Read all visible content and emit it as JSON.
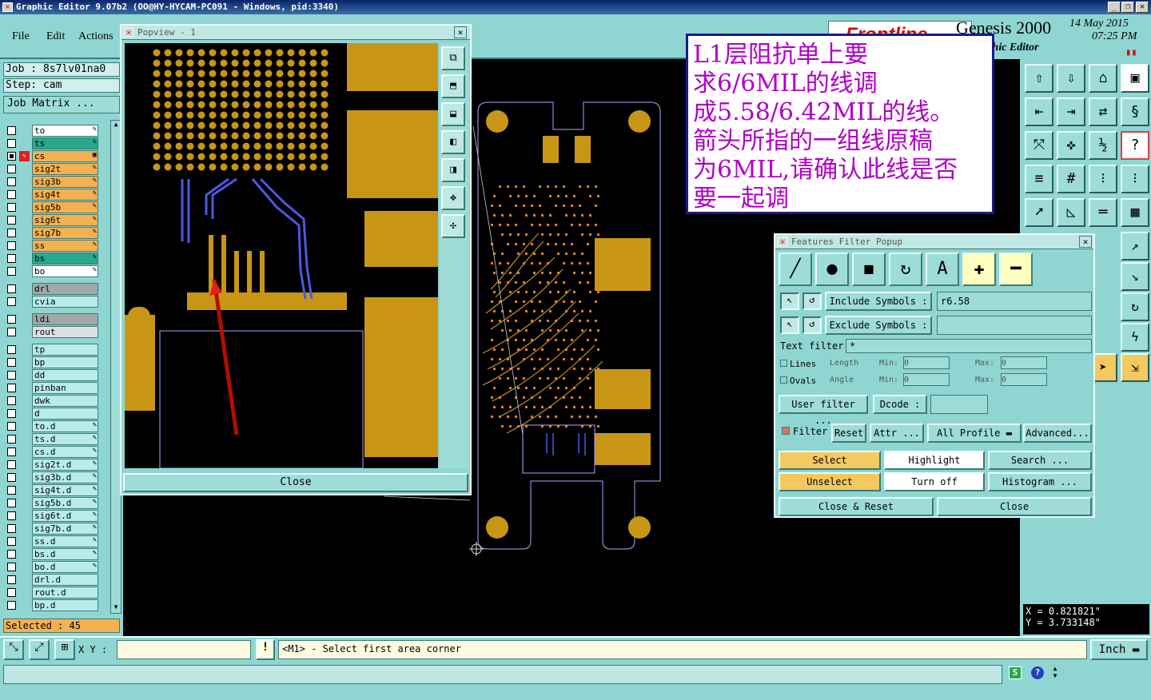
{
  "window_title": "Graphic Editor 9.07b2 (OO@HY-HYCAM-PC091 - Windows, pid:3340)",
  "menu": {
    "file": "File",
    "edit": "Edit",
    "actions": "Actions"
  },
  "job_label": "Job : 8s7lv01na0",
  "step_label": "Step: cam",
  "job_matrix": "Job Matrix ...",
  "layers": [
    {
      "name": "to",
      "color": "#ffffff",
      "checked": false,
      "edit": "✎"
    },
    {
      "name": "ts",
      "color": "#2aa88a",
      "checked": false,
      "edit": "✎"
    },
    {
      "name": "cs",
      "color": "#f5b050",
      "checked": true,
      "edit": "▣"
    },
    {
      "name": "sig2t",
      "color": "#f5b050",
      "checked": false,
      "edit": "✎"
    },
    {
      "name": "sig3b",
      "color": "#f5b050",
      "checked": false,
      "edit": "✎"
    },
    {
      "name": "sig4t",
      "color": "#f5b050",
      "checked": false,
      "edit": "✎"
    },
    {
      "name": "sig5b",
      "color": "#f5b050",
      "checked": false,
      "edit": "✎"
    },
    {
      "name": "sig6t",
      "color": "#f5b050",
      "checked": false,
      "edit": "✎"
    },
    {
      "name": "sig7b",
      "color": "#f5b050",
      "checked": false,
      "edit": "✎"
    },
    {
      "name": "ss",
      "color": "#f5b050",
      "checked": false,
      "edit": "✎"
    },
    {
      "name": "bs",
      "color": "#2aa88a",
      "checked": false,
      "edit": "✎"
    },
    {
      "name": "bo",
      "color": "#ffffff",
      "checked": false,
      "edit": "✎"
    },
    {
      "name": "drl",
      "color": "#a0a8a8",
      "checked": false,
      "edit": ""
    },
    {
      "name": "cvia",
      "color": "#b8ecec",
      "checked": false,
      "edit": ""
    },
    {
      "name": "ldi",
      "color": "#a0a8a8",
      "checked": false,
      "edit": ""
    },
    {
      "name": "rout",
      "color": "#e0e0e0",
      "checked": false,
      "edit": ""
    },
    {
      "name": "tp",
      "color": "#b8ecec",
      "checked": false,
      "edit": ""
    },
    {
      "name": "bp",
      "color": "#b8ecec",
      "checked": false,
      "edit": ""
    },
    {
      "name": "dd",
      "color": "#b8ecec",
      "checked": false,
      "edit": ""
    },
    {
      "name": "pinban",
      "color": "#b8ecec",
      "checked": false,
      "edit": ""
    },
    {
      "name": "dwk",
      "color": "#b8ecec",
      "checked": false,
      "edit": ""
    },
    {
      "name": "d",
      "color": "#b8ecec",
      "checked": false,
      "edit": ""
    },
    {
      "name": "to.d",
      "color": "#b8ecec",
      "checked": false,
      "edit": "✎"
    },
    {
      "name": "ts.d",
      "color": "#b8ecec",
      "checked": false,
      "edit": "✎"
    },
    {
      "name": "cs.d",
      "color": "#b8ecec",
      "checked": false,
      "edit": "✎"
    },
    {
      "name": "sig2t.d",
      "color": "#b8ecec",
      "checked": false,
      "edit": "✎"
    },
    {
      "name": "sig3b.d",
      "color": "#b8ecec",
      "checked": false,
      "edit": "✎"
    },
    {
      "name": "sig4t.d",
      "color": "#b8ecec",
      "checked": false,
      "edit": "✎"
    },
    {
      "name": "sig5b.d",
      "color": "#b8ecec",
      "checked": false,
      "edit": "✎"
    },
    {
      "name": "sig6t.d",
      "color": "#b8ecec",
      "checked": false,
      "edit": "✎"
    },
    {
      "name": "sig7b.d",
      "color": "#b8ecec",
      "checked": false,
      "edit": "✎"
    },
    {
      "name": "ss.d",
      "color": "#b8ecec",
      "checked": false,
      "edit": "✎"
    },
    {
      "name": "bs.d",
      "color": "#b8ecec",
      "checked": false,
      "edit": "✎"
    },
    {
      "name": "bo.d",
      "color": "#b8ecec",
      "checked": false,
      "edit": "✎"
    },
    {
      "name": "drl.d",
      "color": "#b8ecec",
      "checked": false,
      "edit": ""
    },
    {
      "name": "rout.d",
      "color": "#b8ecec",
      "checked": false,
      "edit": ""
    },
    {
      "name": "bp.d",
      "color": "#b8ecec",
      "checked": false,
      "edit": ""
    }
  ],
  "selected": "Selected : 45",
  "popview": {
    "title": "Popview - 1",
    "close": "Close"
  },
  "note": [
    "L1层阻抗单上要",
    "求6/6MIL的线调",
    "成5.58/6.42MIL的线。",
    "箭头所指的一组线原稿",
    "为6MIL,请确认此线是否",
    "要一起调"
  ],
  "genesis": {
    "brand": "Frontline",
    "product": "Genesis 2000",
    "subtitle": "Graphic Editor",
    "date": "14 May 2015",
    "time": "07:25 PM"
  },
  "ffp": {
    "title": "Features Filter Popup",
    "include_label": "Include Symbols :",
    "include_value": "r6.58",
    "exclude_label": "Exclude Symbols :",
    "exclude_value": "",
    "text_filter_label": "Text filter",
    "text_filter_value": "*",
    "lines": "Lines",
    "ovals": "Ovals",
    "length": "Length",
    "angle": "Angle",
    "min": "Min:",
    "max": "Max:",
    "min_len": "0",
    "max_len": "0",
    "min_ang": "0",
    "max_ang": "0",
    "user_filter": "User filter ...",
    "dcode": "Dcode :",
    "filter": "Filter",
    "reset": "Reset",
    "attr": "Attr ...",
    "all_profile": "All Profile",
    "advanced": "Advanced...",
    "select": "Select",
    "highlight": "Highlight",
    "search": "Search ...",
    "unselect": "Unselect",
    "turn_off": "Turn off",
    "histogram": "Histogram ...",
    "close_reset": "Close & Reset",
    "close": "Close"
  },
  "coords": {
    "x": "X = 0.821821\"",
    "y": "Y = 3.733148\""
  },
  "xy_label": "X Y :",
  "prompt": "<M1> - Select first area corner",
  "units": "Inch",
  "colors": {
    "panel": "#8fd6d2",
    "copper": "#c89614",
    "selected_trace": "#4a5ae0",
    "highlight_orange": "#f5b050",
    "note_text": "#b000c8"
  }
}
